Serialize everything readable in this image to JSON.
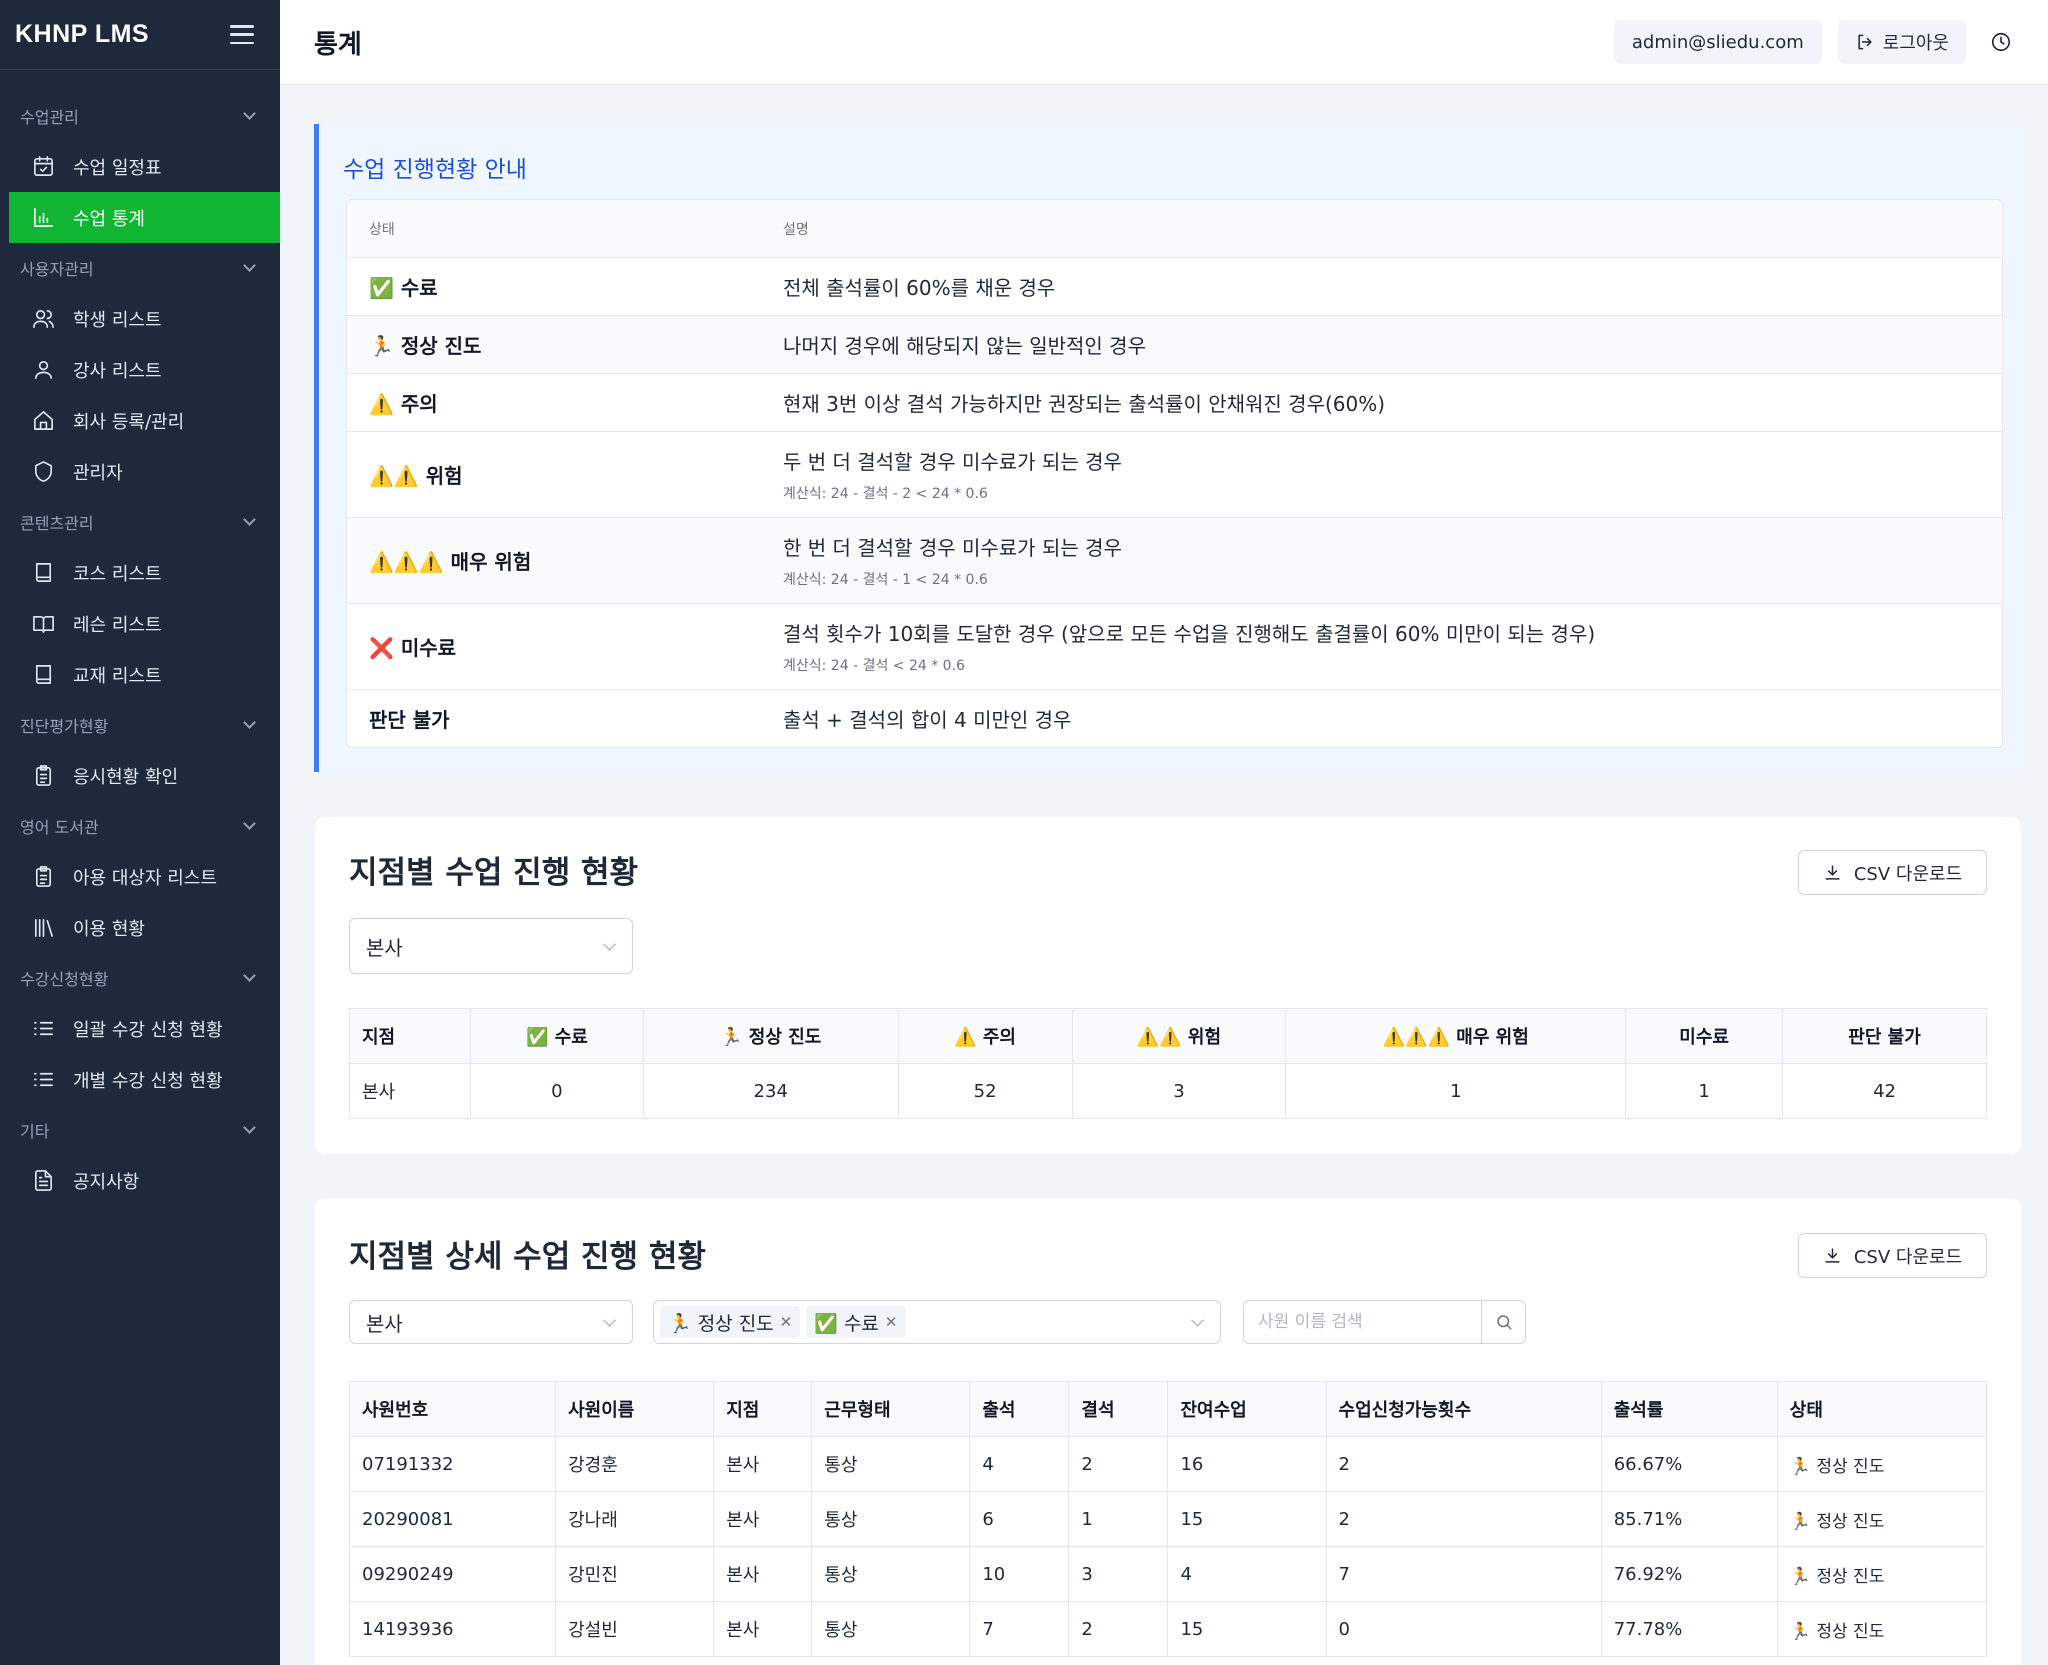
{
  "sidebar": {
    "brand": "KHNP LMS",
    "sections": [
      {
        "label": "수업관리",
        "items": [
          {
            "label": "수업 일정표",
            "icon": "calendar-check-icon"
          },
          {
            "label": "수업 통계",
            "icon": "bar-chart-icon",
            "active": true
          }
        ]
      },
      {
        "label": "사용자관리",
        "items": [
          {
            "label": "학생 리스트",
            "icon": "users-icon"
          },
          {
            "label": "강사 리스트",
            "icon": "user-icon"
          },
          {
            "label": "회사 등록/관리",
            "icon": "home-icon"
          },
          {
            "label": "관리자",
            "icon": "shield-icon"
          }
        ]
      },
      {
        "label": "콘텐츠관리",
        "items": [
          {
            "label": "코스 리스트",
            "icon": "book-icon"
          },
          {
            "label": "레슨 리스트",
            "icon": "book-open-icon"
          },
          {
            "label": "교재 리스트",
            "icon": "book-icon"
          }
        ]
      },
      {
        "label": "진단평가현황",
        "items": [
          {
            "label": "응시현황 확인",
            "icon": "clipboard-icon"
          }
        ]
      },
      {
        "label": "영어 도서관",
        "items": [
          {
            "label": "아용 대상자 리스트",
            "icon": "clipboard-icon"
          },
          {
            "label": "이용 현황",
            "icon": "library-icon"
          }
        ]
      },
      {
        "label": "수강신청현황",
        "items": [
          {
            "label": "일괄 수강 신청 현황",
            "icon": "list-icon"
          },
          {
            "label": "개별 수강 신청 현황",
            "icon": "list-icon"
          }
        ]
      },
      {
        "label": "기타",
        "items": [
          {
            "label": "공지사항",
            "icon": "file-text-icon"
          }
        ]
      }
    ]
  },
  "header": {
    "title": "통계",
    "user_email": "admin@sliedu.com",
    "logout_label": "로그아웃"
  },
  "guide": {
    "title": "수업 진행현황 안내",
    "col_status": "상태",
    "col_desc": "설명",
    "rows": [
      {
        "status": "✅ 수료",
        "desc": "전체 출석률이 60%를 채운 경우",
        "formula": ""
      },
      {
        "status": "🏃 정상 진도",
        "desc": "나머지 경우에 해당되지 않는 일반적인 경우",
        "formula": ""
      },
      {
        "status": "⚠️ 주의",
        "desc": "현재 3번 이상 결석 가능하지만 권장되는 출석률이 안채워진 경우(60%)",
        "formula": ""
      },
      {
        "status": "⚠️⚠️ 위험",
        "desc": "두 번 더 결석할 경우 미수료가 되는 경우",
        "formula": "계산식: 24 - 결석 - 2 < 24 * 0.6"
      },
      {
        "status": "⚠️⚠️⚠️ 매우 위험",
        "desc": "한 번 더 결석할 경우 미수료가 되는 경우",
        "formula": "계산식: 24 - 결석 - 1 < 24 * 0.6"
      },
      {
        "status": "❌ 미수료",
        "desc": "결석 횟수가 10회를 도달한 경우 (앞으로 모든 수업을 진행해도 출결률이 60% 미만이 되는 경우)",
        "formula": "계산식: 24 - 결석 < 24 * 0.6"
      },
      {
        "status": "판단 불가",
        "desc": "출석 + 결석의 합이 4 미만인 경우",
        "formula": ""
      }
    ]
  },
  "summary": {
    "title": "지점별 수업 진행 현황",
    "csv_label": "CSV 다운로드",
    "branch_select": "본사",
    "headers": [
      "지점",
      "✅ 수료",
      "🏃 정상 진도",
      "⚠️ 주의",
      "⚠️⚠️ 위험",
      "⚠️⚠️⚠️ 매우 위험",
      "미수료",
      "판단 불가"
    ],
    "rows": [
      [
        "본사",
        "0",
        "234",
        "52",
        "3",
        "1",
        "1",
        "42"
      ]
    ]
  },
  "detail": {
    "title": "지점별 상세 수업 진행 현황",
    "csv_label": "CSV 다운로드",
    "branch_select": "본사",
    "tags": [
      "🏃 정상 진도",
      "✅ 수료"
    ],
    "search_placeholder": "사원 이름 검색",
    "headers": [
      "사원번호",
      "사원이름",
      "지점",
      "근무형태",
      "출석",
      "결석",
      "잔여수업",
      "수업신청가능횟수",
      "출석률",
      "상태"
    ],
    "rows": [
      [
        "07191332",
        "강경훈",
        "본사",
        "통상",
        "4",
        "2",
        "16",
        "2",
        "66.67%",
        "🏃 정상 진도"
      ],
      [
        "20290081",
        "강나래",
        "본사",
        "통상",
        "6",
        "1",
        "15",
        "2",
        "85.71%",
        "🏃 정상 진도"
      ],
      [
        "09290249",
        "강민진",
        "본사",
        "통상",
        "10",
        "3",
        "4",
        "7",
        "76.92%",
        "🏃 정상 진도"
      ],
      [
        "14193936",
        "강설빈",
        "본사",
        "통상",
        "7",
        "2",
        "15",
        "0",
        "77.78%",
        "🏃 정상 진도"
      ]
    ]
  }
}
